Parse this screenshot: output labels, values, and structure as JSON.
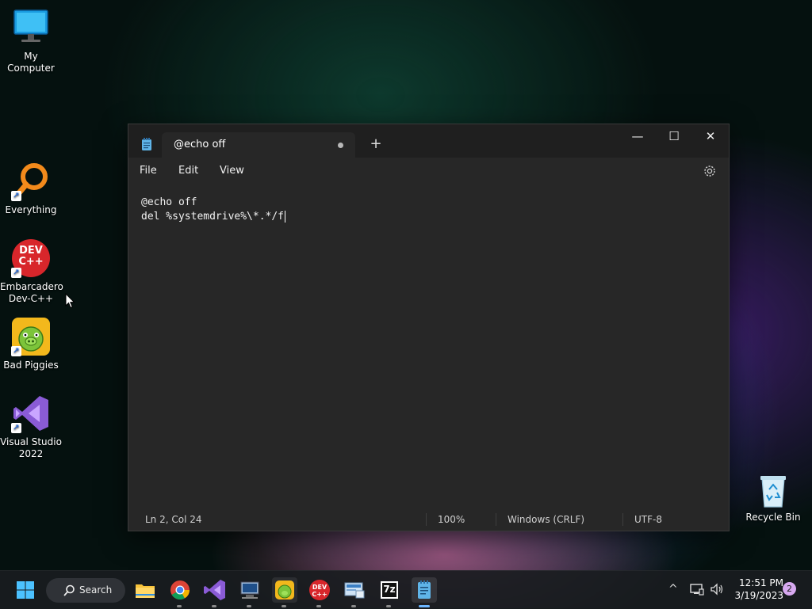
{
  "desktop": {
    "icons": [
      {
        "label": "My Computer",
        "icon": "monitor-icon"
      },
      {
        "label": "Everything",
        "icon": "magnifier-icon"
      },
      {
        "label": "Embarcadero Dev-C++",
        "icon": "devcpp-icon",
        "badge_text": "DEV C++"
      },
      {
        "label": "Bad Piggies",
        "icon": "pig-icon"
      },
      {
        "label": "Visual Studio 2022",
        "icon": "visual-studio-icon"
      }
    ],
    "recycle_bin": {
      "label": "Recycle Bin",
      "icon": "recycle-bin-icon"
    }
  },
  "notepad": {
    "tab_title": "@echo off",
    "new_tab_glyph": "+",
    "menus": [
      "File",
      "Edit",
      "View"
    ],
    "content_lines": [
      "@echo off",
      "del %systemdrive%\\*.*/f"
    ],
    "status": {
      "position": "Ln 2, Col 24",
      "zoom": "100%",
      "line_ending": "Windows (CRLF)",
      "encoding": "UTF-8"
    },
    "window_controls": {
      "minimize": "—",
      "maximize": "☐",
      "close": "✕"
    }
  },
  "taskbar": {
    "search_label": "Search",
    "apps": [
      "file-explorer",
      "chrome",
      "visual-studio",
      "remote-desktop",
      "bad-piggies",
      "dev-cpp",
      "control-panel",
      "7zip",
      "notepad"
    ],
    "sevenzip_text": "7z",
    "devcpp_text": "DEV C++",
    "clock_time": "12:51 PM",
    "clock_date": "3/19/2023",
    "notification_count": "2",
    "tray_chevron": "^"
  },
  "colors": {
    "window_bg": "#272727",
    "titlebar_bg": "#1f1f1f",
    "accent": "#6cb6ff"
  }
}
